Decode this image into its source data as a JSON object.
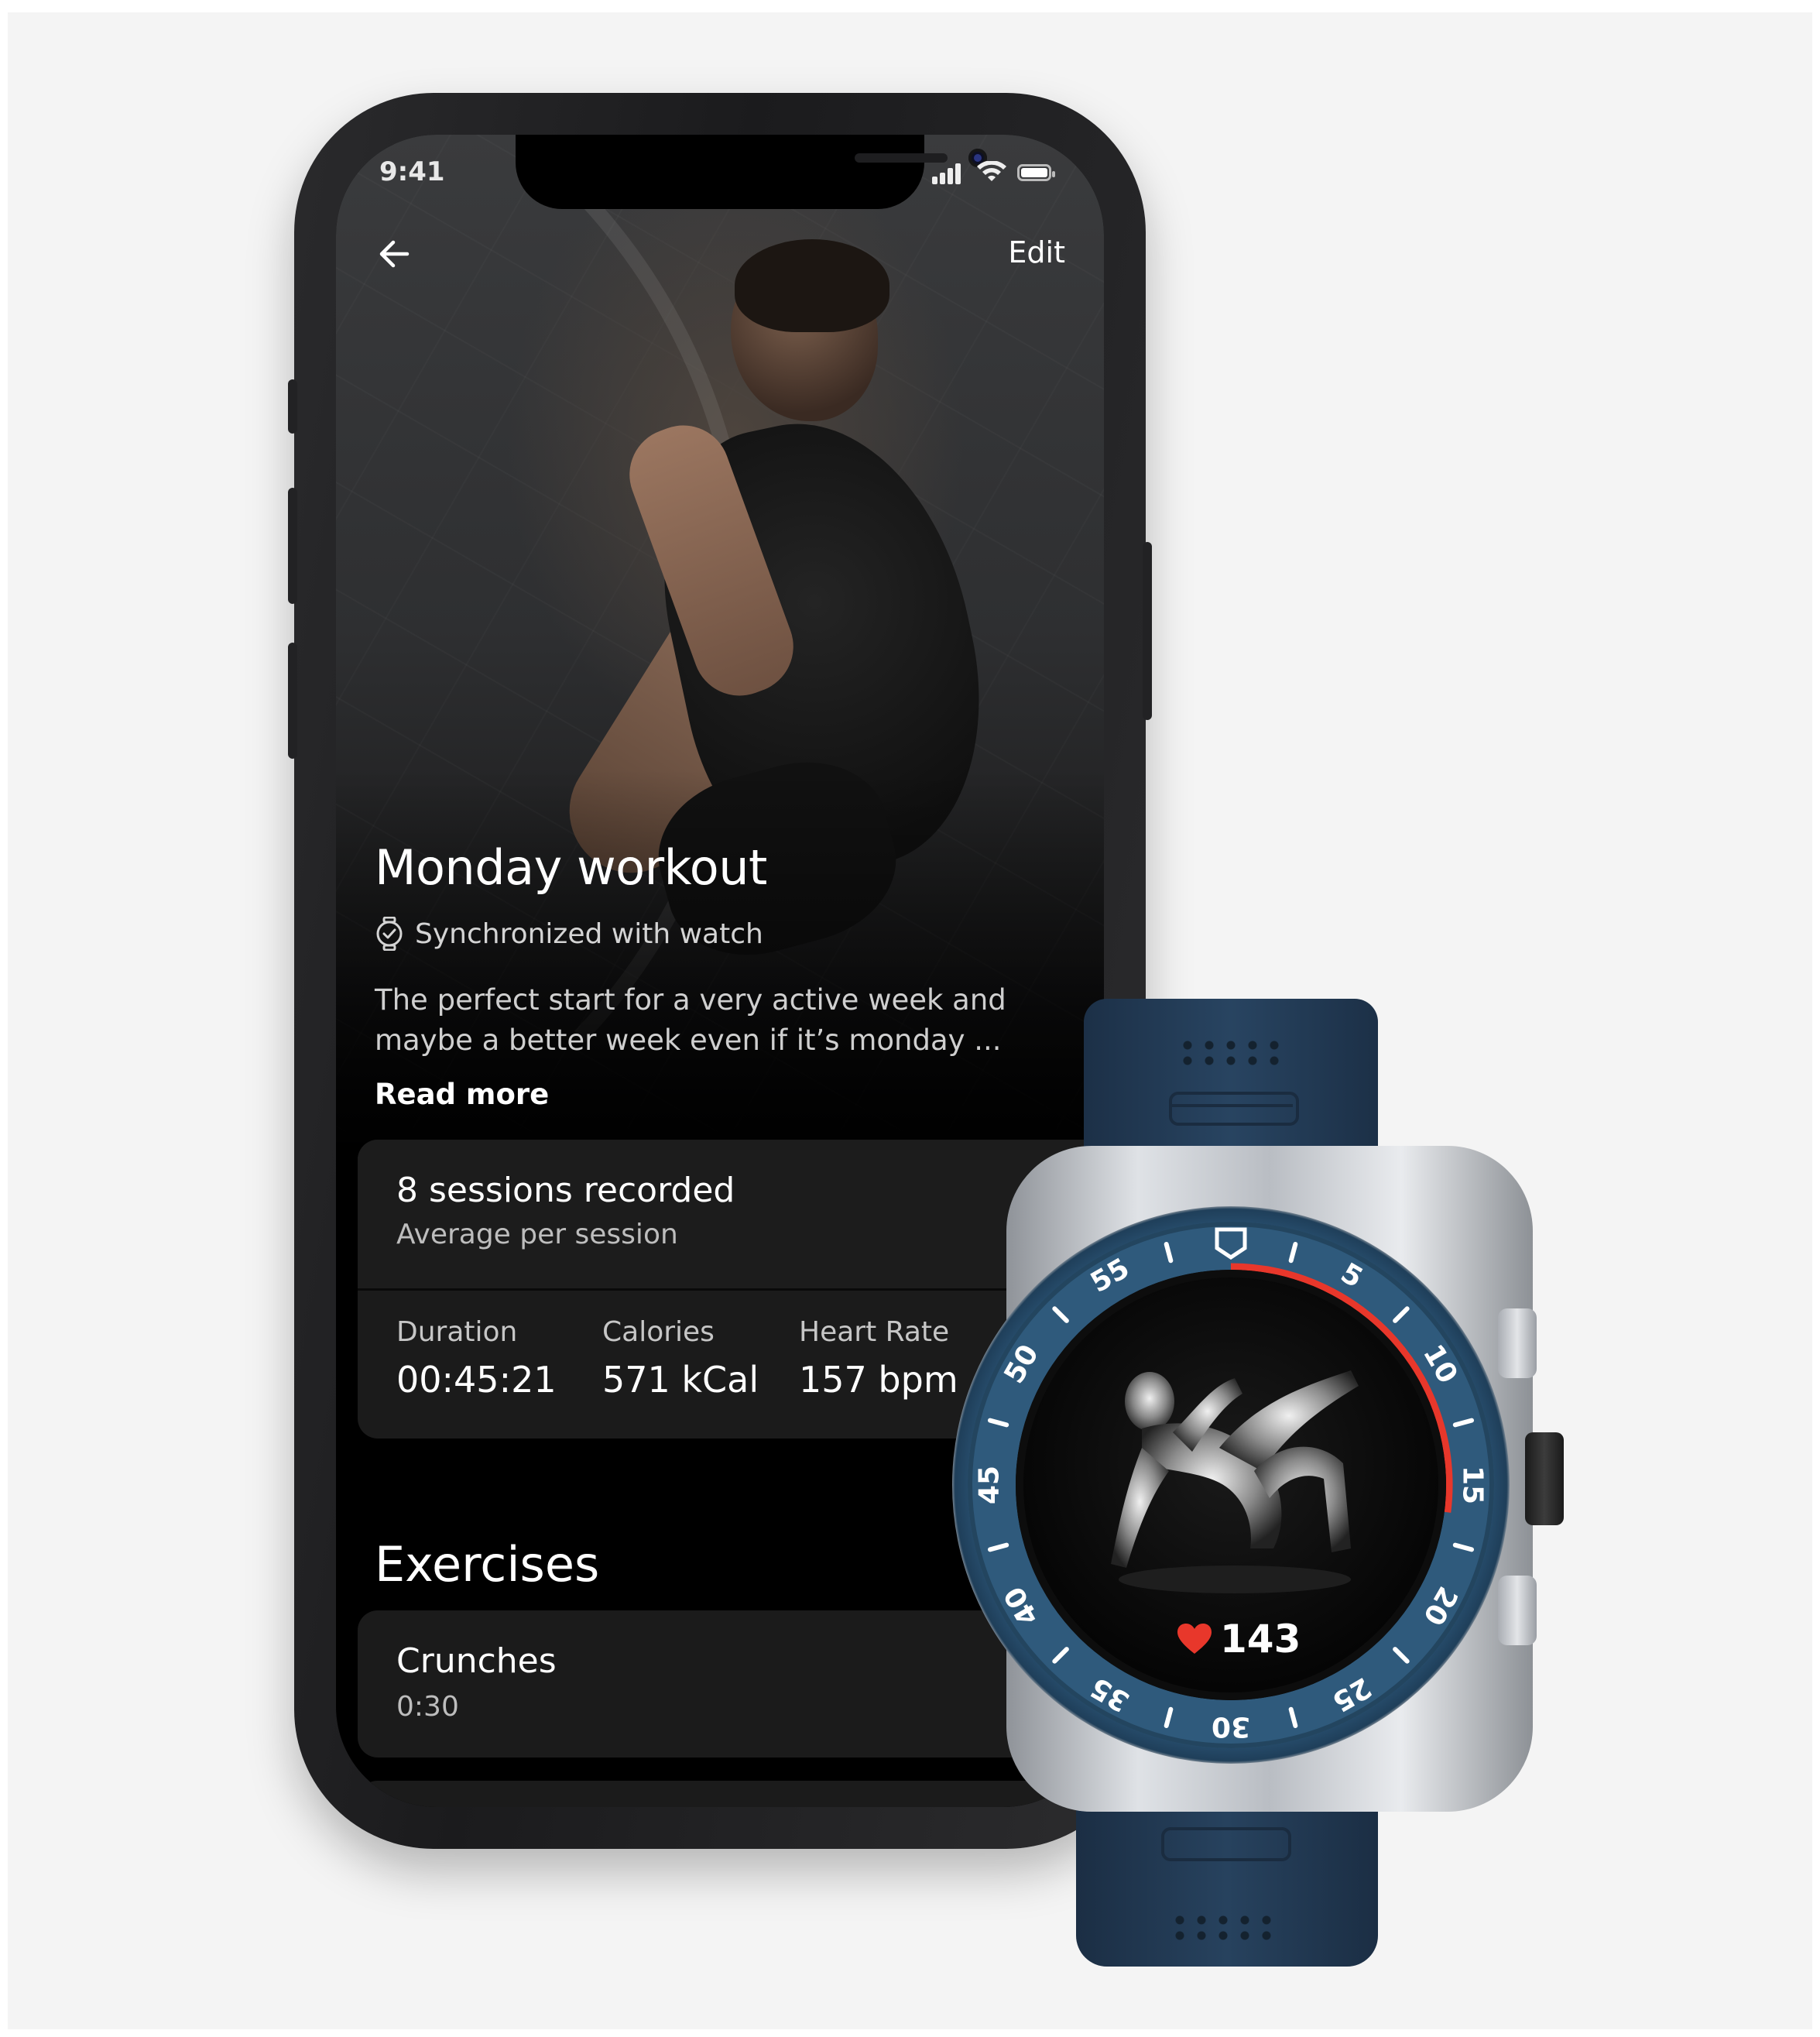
{
  "status_bar": {
    "time": "9:41"
  },
  "header": {
    "edit_label": "Edit",
    "back_icon": "arrow-left-icon"
  },
  "workout": {
    "title": "Monday workout",
    "sync_label": "Synchronized with watch",
    "description": "The perfect start for a very active week and maybe a better week even if it’s monday ...",
    "read_more": "Read more"
  },
  "sessions": {
    "title": "8 sessions recorded",
    "subtitle": "Average per session",
    "stats": [
      {
        "label": "Duration",
        "value": "00:45:21"
      },
      {
        "label": "Calories",
        "value": "571 kCal"
      },
      {
        "label": "Heart Rate",
        "value": "157 bpm"
      }
    ]
  },
  "exercises": {
    "heading": "Exercises",
    "items": [
      {
        "name": "Crunches",
        "duration": "0:30"
      }
    ]
  },
  "watch": {
    "heart_rate": "143",
    "bezel_numbers": [
      "5",
      "10",
      "15",
      "20",
      "25",
      "30",
      "35",
      "40",
      "45",
      "50",
      "55"
    ],
    "progress_fraction": 0.27,
    "colors": {
      "bezel": "#2f5a7c",
      "accent": "#e8372b",
      "strap": "#243d57"
    }
  }
}
